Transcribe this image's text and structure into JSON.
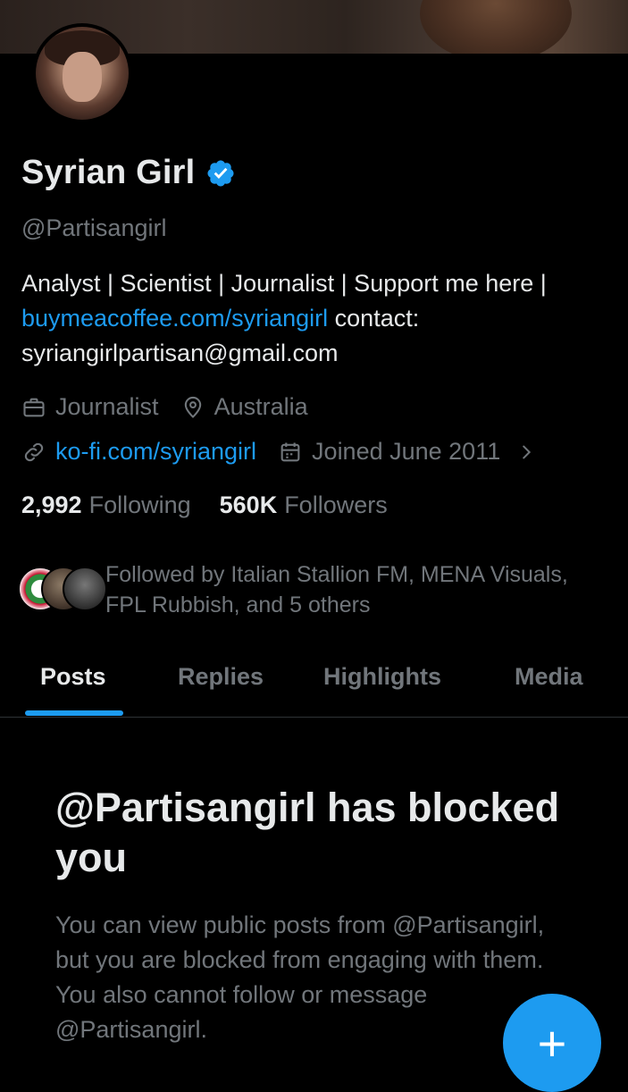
{
  "profile": {
    "name": "Syrian Girl",
    "handle": "@Partisangirl",
    "verified_icon": "verified-badge-icon",
    "bio": {
      "text_1": "Analyst | Scientist | Journalist | Support me here | ",
      "link": "buymeacoffee.com/syriangirl",
      "text_2": " contact: syriangirlpartisan@gmail.com"
    },
    "category": "Journalist",
    "location": "Australia",
    "website": "ko-fi.com/syriangirl",
    "joined": "Joined June 2011"
  },
  "stats": {
    "following_count": "2,992",
    "following_label": "Following",
    "followers_count": "560K",
    "followers_label": "Followers"
  },
  "followed_by": "Followed by Italian Stallion FM, MENA Visuals, FPL Rubbish, and 5 others",
  "tabs": [
    {
      "label": "Posts"
    },
    {
      "label": "Replies"
    },
    {
      "label": "Highlights"
    },
    {
      "label": "Media"
    }
  ],
  "blocked": {
    "title": "@Partisangirl has blocked you",
    "description": "You can view public posts from @Partisangirl, but you are blocked from engaging with them. You also cannot follow or message @Partisangirl."
  },
  "fab": {
    "label": "+"
  },
  "colors": {
    "accent": "#1d9bf0",
    "muted": "#71767b",
    "text": "#e7e9ea",
    "background": "#000000"
  }
}
